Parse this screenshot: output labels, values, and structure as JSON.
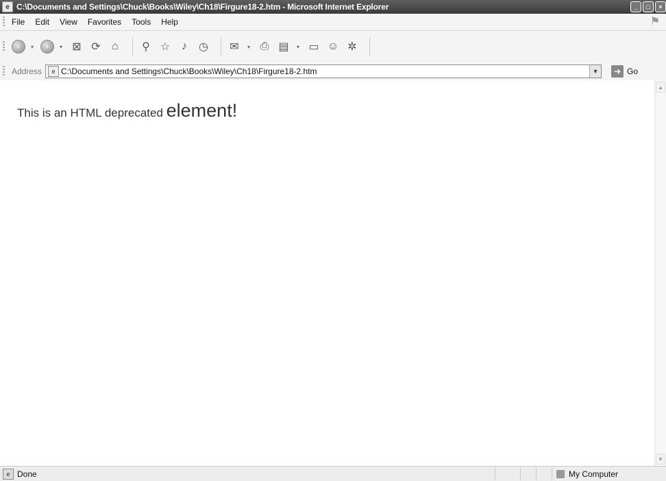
{
  "window": {
    "title": "C:\\Documents and Settings\\Chuck\\Books\\Wiley\\Ch18\\Firgure18-2.htm - Microsoft Internet Explorer",
    "controls": {
      "minimize": "_",
      "maximize": "□",
      "close": "×"
    }
  },
  "menu": {
    "items": [
      "File",
      "Edit",
      "View",
      "Favorites",
      "Tools",
      "Help"
    ]
  },
  "toolbar": {
    "icons": [
      "back-icon",
      "forward-icon",
      "stop-icon",
      "refresh-icon",
      "home-icon",
      "search-icon",
      "favorites-icon",
      "media-icon",
      "history-icon",
      "mail-icon",
      "print-icon",
      "edit-icon",
      "discuss-icon",
      "messenger-icon"
    ]
  },
  "address": {
    "label": "Address",
    "value": "C:\\Documents and Settings\\Chuck\\Books\\Wiley\\Ch18\\Firgure18-2.htm",
    "go_label": "Go"
  },
  "page": {
    "text_normal": "This is an HTML deprecated ",
    "text_big": "element!"
  },
  "status": {
    "text": "Done",
    "zone": "My Computer"
  }
}
